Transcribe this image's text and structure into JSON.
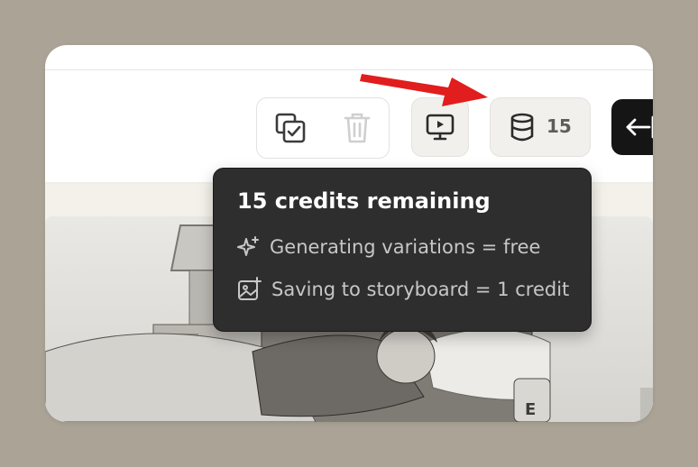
{
  "toolbar": {
    "credits_count": "15"
  },
  "tooltip": {
    "title": "15 credits remaining",
    "rows": [
      {
        "icon": "sparkle-icon",
        "label": "Generating variations = free"
      },
      {
        "icon": "image-add-icon",
        "label": "Saving to storyboard = 1 credit"
      }
    ]
  },
  "colors": {
    "background": "#aaa396",
    "tooltip_bg": "#2e2e2e",
    "annotation_arrow": "#e11d1d"
  }
}
